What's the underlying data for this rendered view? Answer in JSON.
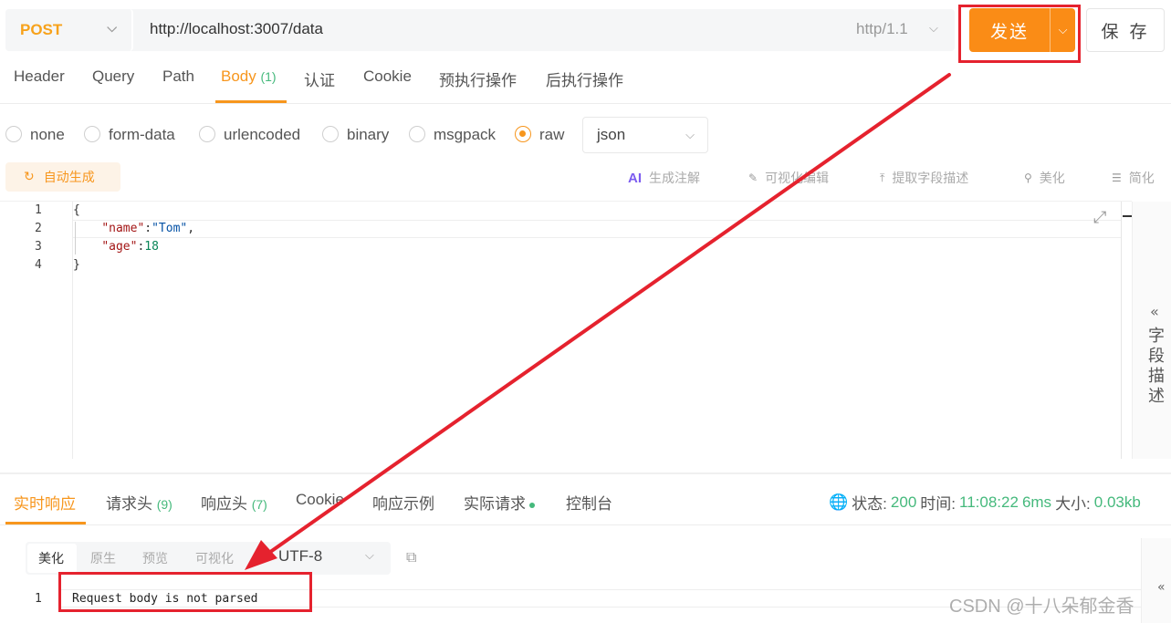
{
  "request": {
    "method": "POST",
    "url": "http://localhost:3007/data",
    "protocol": "http/1.1",
    "send_label": "发送",
    "save_label": "保 存"
  },
  "tabs": {
    "header": "Header",
    "query": "Query",
    "path": "Path",
    "body": "Body",
    "body_count": "(1)",
    "auth": "认证",
    "cookie": "Cookie",
    "pre": "预执行操作",
    "post": "后执行操作"
  },
  "body_types": {
    "none": "none",
    "form_data": "form-data",
    "urlencoded": "urlencoded",
    "binary": "binary",
    "msgpack": "msgpack",
    "raw": "raw",
    "selected": "raw",
    "format": "json"
  },
  "toolbar": {
    "auto_generate": "自动生成",
    "ai_badge": "AI",
    "gen_comment": "生成注解",
    "visual_edit": "可视化编辑",
    "extract_fields": "提取字段描述",
    "beautify": "美化",
    "simplify": "简化"
  },
  "editor": {
    "line_numbers": [
      "1",
      "2",
      "3",
      "4"
    ],
    "line1": "{",
    "line2_key": "\"name\"",
    "line2_sep": ":",
    "line2_val": "\"Tom\"",
    "line2_end": ",",
    "line3_key": "\"age\"",
    "line3_sep": ":",
    "line3_val": "18",
    "line4": "}"
  },
  "side_panel": {
    "chars": [
      "字",
      "段",
      "描",
      "述"
    ]
  },
  "response": {
    "tabs": {
      "live": "实时响应",
      "req_headers": "请求头",
      "req_headers_count": "(9)",
      "resp_headers": "响应头",
      "resp_headers_count": "(7)",
      "cookie": "Cookie",
      "examples": "响应示例",
      "actual": "实际请求",
      "console": "控制台"
    },
    "status_label": "状态:",
    "status_value": "200",
    "time_label": "时间:",
    "time_value": "11:08:22",
    "duration": "6ms",
    "size_label": "大小:",
    "size_value": "0.03kb",
    "view_modes": {
      "pretty": "美化",
      "raw": "原生",
      "preview": "预览",
      "visual": "可视化"
    },
    "encoding": "UTF-8",
    "line_number": "1",
    "body_text": "Request body is not parsed"
  },
  "watermark": "CSDN @十八朵郁金香",
  "colors": {
    "accent": "#f7961d",
    "send": "#fa8c16",
    "annotation": "#e5222e",
    "success": "#45b97c"
  }
}
